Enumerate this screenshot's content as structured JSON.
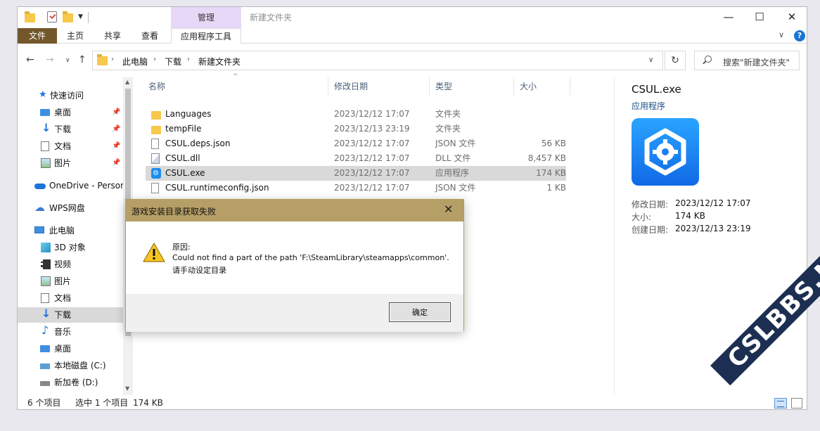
{
  "window": {
    "title": "新建文件夹",
    "contextual_tab_group": "管理"
  },
  "ribbon": {
    "tabs": [
      "文件",
      "主页",
      "共享",
      "查看",
      "应用程序工具"
    ]
  },
  "address": {
    "crumbs": [
      "此电脑",
      "下载",
      "新建文件夹"
    ],
    "search_placeholder": "搜索\"新建文件夹\""
  },
  "sidebar": {
    "items": [
      {
        "label": "快速访问",
        "icon": "star-icon"
      },
      {
        "label": "桌面",
        "icon": "desktop-icon",
        "pinned": true
      },
      {
        "label": "下载",
        "icon": "download-icon",
        "pinned": true
      },
      {
        "label": "文档",
        "icon": "document-icon",
        "pinned": true
      },
      {
        "label": "图片",
        "icon": "picture-icon",
        "pinned": true
      },
      {
        "label": "OneDrive - Persor",
        "icon": "onedrive-icon"
      },
      {
        "label": "WPS网盘",
        "icon": "cloud-icon"
      },
      {
        "label": "此电脑",
        "icon": "computer-icon"
      },
      {
        "label": "3D 对象",
        "icon": "3d-objects-icon"
      },
      {
        "label": "视频",
        "icon": "video-icon"
      },
      {
        "label": "图片",
        "icon": "picture-icon"
      },
      {
        "label": "文档",
        "icon": "document-icon"
      },
      {
        "label": "下载",
        "icon": "download-icon",
        "selected": true
      },
      {
        "label": "音乐",
        "icon": "music-icon"
      },
      {
        "label": "桌面",
        "icon": "desktop-icon"
      },
      {
        "label": "本地磁盘 (C:)",
        "icon": "local-disk-icon"
      },
      {
        "label": "新加卷 (D:)",
        "icon": "drive-icon"
      }
    ]
  },
  "filelist": {
    "columns": [
      "名称",
      "修改日期",
      "类型",
      "大小"
    ],
    "rows": [
      {
        "name": "Languages",
        "date": "2023/12/12 17:07",
        "type": "文件夹",
        "size": "",
        "icon": "folder-icon"
      },
      {
        "name": "tempFile",
        "date": "2023/12/13 23:19",
        "type": "文件夹",
        "size": "",
        "icon": "folder-icon"
      },
      {
        "name": "CSUL.deps.json",
        "date": "2023/12/12 17:07",
        "type": "JSON 文件",
        "size": "56 KB",
        "icon": "json-file-icon"
      },
      {
        "name": "CSUL.dll",
        "date": "2023/12/12 17:07",
        "type": "DLL 文件",
        "size": "8,457 KB",
        "icon": "dll-file-icon"
      },
      {
        "name": "CSUL.exe",
        "date": "2023/12/12 17:07",
        "type": "应用程序",
        "size": "174 KB",
        "icon": "exe-app-icon",
        "selected": true
      },
      {
        "name": "CSUL.runtimeconfig.json",
        "date": "2023/12/12 17:07",
        "type": "JSON 文件",
        "size": "1 KB",
        "icon": "json-file-icon"
      }
    ]
  },
  "details": {
    "title": "CSUL.exe",
    "subtitle": "应用程序",
    "props": [
      {
        "label": "修改日期:",
        "value": "2023/12/12 17:07"
      },
      {
        "label": "大小:",
        "value": "174 KB"
      },
      {
        "label": "创建日期:",
        "value": "2023/12/13 23:19"
      }
    ]
  },
  "status": {
    "count": "6 个项目",
    "selection": "选中 1 个项目",
    "size": "174 KB"
  },
  "dialog": {
    "title": "游戏安装目录获取失败",
    "lines": [
      "原因:",
      "Could not find a part of the path 'F:\\SteamLibrary\\steamapps\\common'.",
      "请手动设定目录"
    ],
    "ok_label": "确定"
  },
  "watermark": "CSLBBS.NET"
}
